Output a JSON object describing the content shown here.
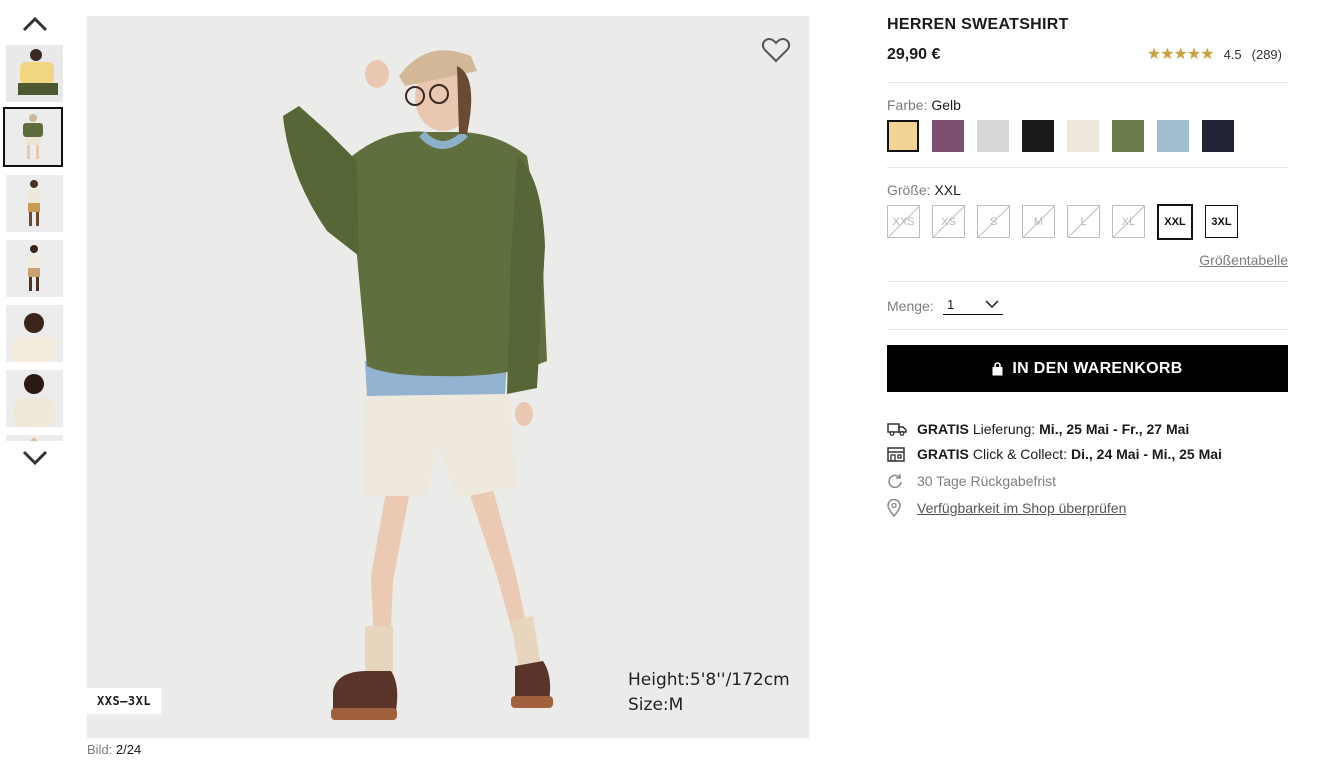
{
  "gallery": {
    "main_image_alt": "model in green sweatshirt",
    "size_range_tag": "XXS–3XL",
    "model_height": "Height:5'8''/172cm",
    "model_size": "Size:M",
    "counter_label": "Bild:",
    "counter_value": "2/24"
  },
  "product": {
    "title": "HERREN SWEATSHIRT",
    "price": "29,90 €",
    "rating_stars": "★★★★★",
    "rating_value": "4.5",
    "rating_count": "(289)"
  },
  "color": {
    "label": "Farbe:",
    "selected": "Gelb",
    "swatches": [
      "#f2d595",
      "#7d4f70",
      "#d7d7d7",
      "#1b1b1b",
      "#efe8dc",
      "#697c4a",
      "#a1bfcf",
      "#222436"
    ]
  },
  "size": {
    "label": "Größe:",
    "selected": "XXL",
    "options": [
      "XXS",
      "XS",
      "S",
      "M",
      "L",
      "XL",
      "XXL",
      "3XL"
    ],
    "chart_link": "Größentabelle"
  },
  "quantity": {
    "label": "Menge:",
    "value": "1"
  },
  "cart": {
    "button_label": "IN DEN WARENKORB"
  },
  "delivery": {
    "shipping_free": "GRATIS",
    "shipping_text": "Lieferung:",
    "shipping_dates": "Mi., 25 Mai - Fr., 27 Mai",
    "collect_free": "GRATIS",
    "collect_text": "Click & Collect:",
    "collect_dates": "Di., 24 Mai - Mi., 25 Mai",
    "returns": "30 Tage Rückgabefrist",
    "availability_link": "Verfügbarkeit im Shop überprüfen"
  },
  "colors": {
    "accent": "#000000",
    "star": "#c9a13b"
  }
}
